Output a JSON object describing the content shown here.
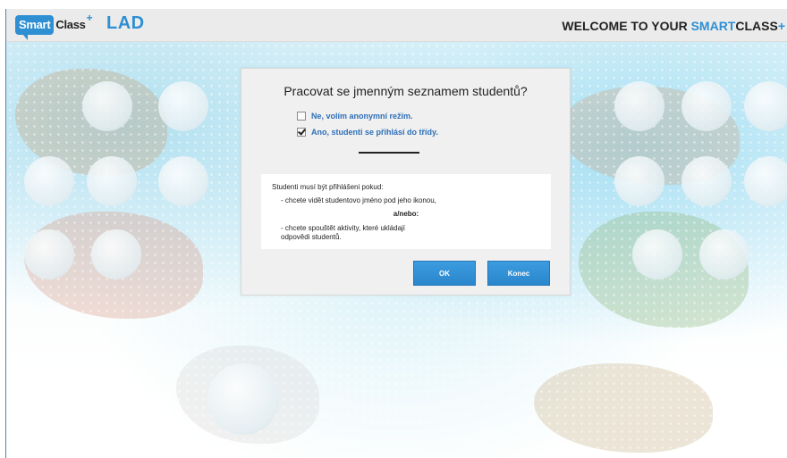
{
  "header": {
    "logo_smart": "Smart",
    "logo_class": "Class",
    "logo_plus": "+",
    "app_name": "LAD",
    "welcome_prefix": "WELCOME TO YOUR ",
    "welcome_accent": "SMART",
    "welcome_suffix": "CLASS",
    "welcome_plus": "+"
  },
  "dialog": {
    "title": "Pracovat se jmenným seznamem studentů?",
    "options": [
      {
        "label": "Ne, volím anonymní režim.",
        "checked": false
      },
      {
        "label": "Ano, studenti se přihlásí do třídy.",
        "checked": true
      }
    ],
    "info": {
      "line1": "Studenti musí být přihlášeni pokud:",
      "line2": "- chcete vidět studentovo jméno pod jeho ikonou,",
      "line3": "a/nebo:",
      "line4": "- chcete spouštět aktivity, které ukládají",
      "line5": "odpovědi studentů."
    },
    "ok_label": "OK",
    "end_label": "Konec"
  },
  "colors": {
    "accent": "#2e8fd3",
    "button": "#2a86cc",
    "dialog_bg": "#f0f0f0"
  }
}
